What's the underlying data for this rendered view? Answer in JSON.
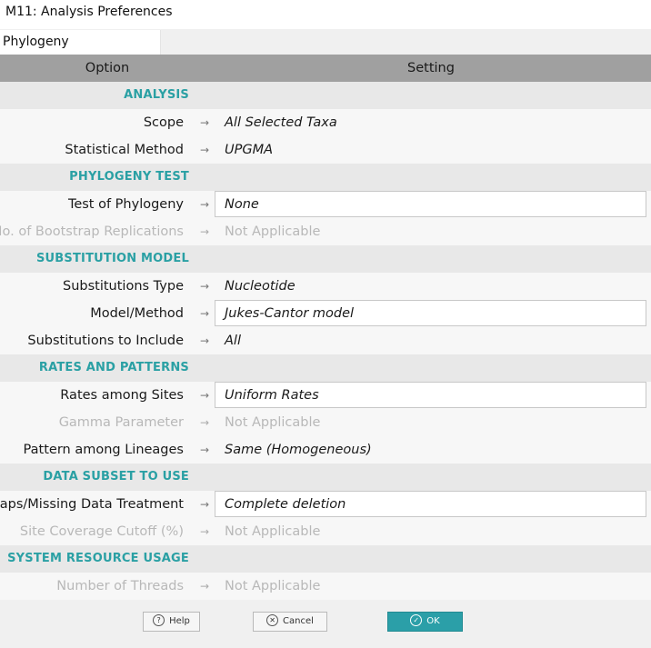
{
  "window": {
    "title": "M11: Analysis Preferences"
  },
  "tabs": [
    {
      "label": "Phylogeny Reconstruction"
    }
  ],
  "grid": {
    "header": {
      "option": "Option",
      "setting": "Setting"
    },
    "rows": [
      {
        "kind": "section",
        "label": "ANALYSIS"
      },
      {
        "kind": "option",
        "label": "Scope",
        "value": "All Selected Taxa",
        "enabled": true,
        "editable": false
      },
      {
        "kind": "option",
        "label": "Statistical Method",
        "value": "UPGMA",
        "enabled": true,
        "editable": false
      },
      {
        "kind": "section",
        "label": "PHYLOGENY TEST"
      },
      {
        "kind": "option",
        "label": "Test of Phylogeny",
        "value": "None",
        "enabled": true,
        "editable": true
      },
      {
        "kind": "option",
        "label": "No. of Bootstrap Replications",
        "value": "Not Applicable",
        "enabled": false,
        "editable": false
      },
      {
        "kind": "section",
        "label": "SUBSTITUTION MODEL"
      },
      {
        "kind": "option",
        "label": "Substitutions Type",
        "value": "Nucleotide",
        "enabled": true,
        "editable": false
      },
      {
        "kind": "option",
        "label": "Model/Method",
        "value": "Jukes-Cantor model",
        "enabled": true,
        "editable": true
      },
      {
        "kind": "option",
        "label": "Substitutions to Include",
        "value": "All",
        "enabled": true,
        "editable": false
      },
      {
        "kind": "section",
        "label": "RATES AND PATTERNS"
      },
      {
        "kind": "option",
        "label": "Rates among Sites",
        "value": "Uniform Rates",
        "enabled": true,
        "editable": true
      },
      {
        "kind": "option",
        "label": "Gamma Parameter",
        "value": "Not Applicable",
        "enabled": false,
        "editable": false
      },
      {
        "kind": "option",
        "label": "Pattern among Lineages",
        "value": "Same (Homogeneous)",
        "enabled": true,
        "editable": false
      },
      {
        "kind": "section",
        "label": "DATA SUBSET TO USE"
      },
      {
        "kind": "option",
        "label": "Gaps/Missing Data Treatment",
        "value": "Complete deletion",
        "enabled": true,
        "editable": true
      },
      {
        "kind": "option",
        "label": "Site Coverage Cutoff (%)",
        "value": "Not Applicable",
        "enabled": false,
        "editable": false
      },
      {
        "kind": "section",
        "label": "SYSTEM RESOURCE USAGE"
      },
      {
        "kind": "option",
        "label": "Number of Threads",
        "value": "Not Applicable",
        "enabled": false,
        "editable": false
      }
    ]
  },
  "buttons": {
    "help": {
      "label": "Help",
      "icon": "question-icon",
      "glyph": "?"
    },
    "cancel": {
      "label": "Cancel",
      "icon": "close-circle-icon",
      "glyph": "✕"
    },
    "ok": {
      "label": "OK",
      "icon": "check-circle-icon",
      "glyph": "✓"
    }
  },
  "colors": {
    "section_text": "#2aa0a4",
    "header_bg": "#a0a0a0",
    "ok_button_bg": "#2b9fa8",
    "disabled_text": "#b8b8b8"
  },
  "arrow_glyph": "→"
}
